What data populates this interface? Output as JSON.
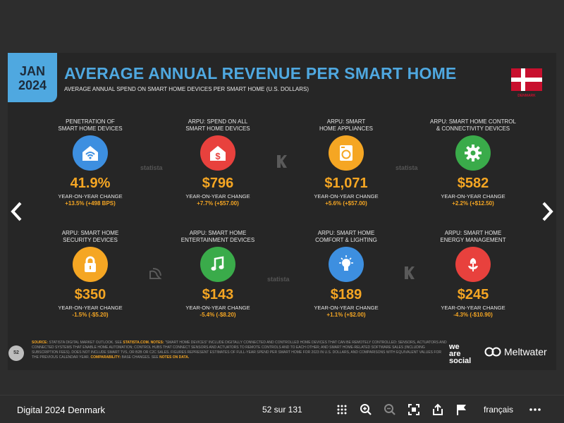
{
  "slide": {
    "date": {
      "month": "JAN",
      "year": "2024"
    },
    "title": "AVERAGE ANNUAL REVENUE PER SMART HOME",
    "subtitle": "AVERAGE ANNUAL SPEND ON SMART HOME DEVICES PER SMART HOME (U.S. DOLLARS)",
    "country": "DENMARK",
    "watermarks": {
      "statista": "statista"
    },
    "metrics": [
      {
        "label": "PENETRATION OF\nSMART HOME DEVICES",
        "icon": "wifi-house-icon",
        "color": "#3d8fe0",
        "value": "41.9%",
        "change_label": "YEAR-ON-YEAR CHANGE",
        "change": "+13.5% (+498 BPS)"
      },
      {
        "label": "ARPU: SPEND ON ALL\nSMART HOME DEVICES",
        "icon": "dollar-house-icon",
        "color": "#e8413d",
        "value": "$796",
        "change_label": "YEAR-ON-YEAR CHANGE",
        "change": "+7.7% (+$57.00)"
      },
      {
        "label": "ARPU: SMART\nHOME APPLIANCES",
        "icon": "washing-machine-icon",
        "color": "#f5a623",
        "value": "$1,071",
        "change_label": "YEAR-ON-YEAR CHANGE",
        "change": "+5.6% (+$57.00)"
      },
      {
        "label": "ARPU: SMART HOME CONTROL\n& CONNECTIVITY DEVICES",
        "icon": "gear-icon",
        "color": "#3aab4a",
        "value": "$582",
        "change_label": "YEAR-ON-YEAR CHANGE",
        "change": "+2.2% (+$12.50)"
      },
      {
        "label": "ARPU: SMART HOME\nSECURITY DEVICES",
        "icon": "lock-icon",
        "color": "#f5a623",
        "value": "$350",
        "change_label": "YEAR-ON-YEAR CHANGE",
        "change": "-1.5% (-$5.20)"
      },
      {
        "label": "ARPU: SMART HOME\nENTERTAINMENT DEVICES",
        "icon": "music-note-icon",
        "color": "#3aab4a",
        "value": "$143",
        "change_label": "YEAR-ON-YEAR CHANGE",
        "change": "-5.4% (-$8.20)"
      },
      {
        "label": "ARPU: SMART HOME\nCOMFORT & LIGHTING",
        "icon": "light-bulb-icon",
        "color": "#3d8fe0",
        "value": "$189",
        "change_label": "YEAR-ON-YEAR CHANGE",
        "change": "+1.1% (+$2.00)"
      },
      {
        "label": "ARPU: SMART HOME\nENERGY MANAGEMENT",
        "icon": "plant-icon",
        "color": "#e8413d",
        "value": "$245",
        "change_label": "YEAR-ON-YEAR CHANGE",
        "change": "-4.3% (-$10.90)"
      }
    ],
    "footnote": {
      "source_label": "SOURCE:",
      "source_text": "STATISTA DIGITAL MARKET OUTLOOK. SEE",
      "source_link": "STATISTA.COM.",
      "notes_label": "NOTES:",
      "notes_text": "\"SMART HOME DEVICES\" INCLUDE DIGITALLY CONNECTED AND CONTROLLED HOME DEVICES THAT CAN BE REMOTELY CONTROLLED: SENSORS, ACTUATORS AND CONNECTED SYSTEMS THAT ENABLE HOME AUTOMATION; CONTROL HUBS THAT CONNECT SENSORS AND ACTUATORS TO REMOTE CONTROLS AND TO EACH OTHER; AND SMART HOME-RELATED SOFTWARE SALES (INCLUDING SUBSCRIPTION FEES). DOES NOT INCLUDE SMART TVS, OR B2B OR C2C SALES. FIGURES REPRESENT ESTIMATES OF FULL-YEAR SPEND PER SMART HOME FOR 2023 IN U.S. DOLLARS, AND COMPARISONS WITH EQUIVALENT VALUES FOR THE PREVIOUS CALENDAR YEAR.",
      "comparability_label": "COMPARABILITY:",
      "comparability_text": "BASE CHANGES. SEE",
      "data_link": "NOTES ON DATA."
    },
    "page_number": "52",
    "brand_was": [
      "we",
      "are",
      "social"
    ],
    "brand_meltwater": "Meltwater"
  },
  "toolbar": {
    "doc_title": "Digital 2024 Denmark",
    "page_count": "52 sur 131",
    "language": "français",
    "icons": [
      "grid-icon",
      "zoom-in-icon",
      "zoom-out-icon",
      "fullscreen-icon",
      "share-icon",
      "flag-icon",
      "more-icon"
    ]
  },
  "nav": {
    "prev": "‹",
    "next": "›"
  }
}
